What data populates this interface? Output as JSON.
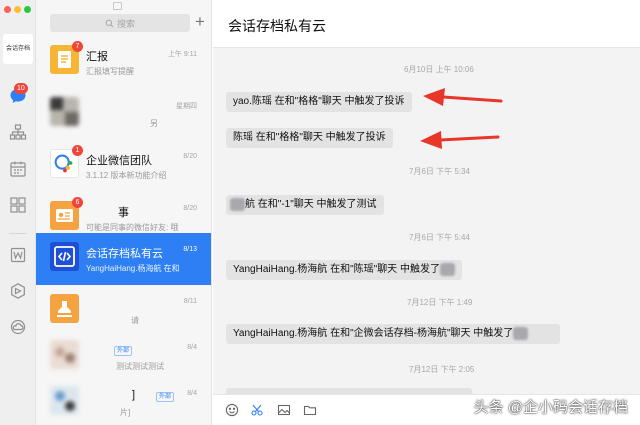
{
  "rail": {
    "org_logo_text": "会话存档",
    "message_badge": "10",
    "icons": [
      "message-icon",
      "org-chart-icon",
      "calendar-icon",
      "grid-icon",
      "doc-icon",
      "drive-icon",
      "cloud-icon"
    ]
  },
  "list": {
    "search_placeholder": "搜索",
    "add_label": "+",
    "conversations": [
      {
        "name": "汇报",
        "preview": "汇报填写提醒",
        "time": "上午 9:11",
        "badge": "7",
        "active": false
      },
      {
        "name": "",
        "preview": "另",
        "time": "星期四",
        "badge": "",
        "active": false
      },
      {
        "name": "企业微信团队",
        "preview": "3.1.12 版本新功能介绍",
        "time": "8/20",
        "badge": "1",
        "active": false
      },
      {
        "name": "事",
        "preview": "可能是同事的微信好友: 哦",
        "time": "8/20",
        "badge": "6",
        "active": false
      },
      {
        "name": "会话存档私有云",
        "preview": "YangHaiHang.杨海航 在和",
        "time": "8/13",
        "badge": "",
        "active": true
      },
      {
        "name": "",
        "preview": "请",
        "time": "8/11",
        "badge": "",
        "active": false
      },
      {
        "name": "",
        "preview": "测试测试测试",
        "time": "8/4",
        "badge": "",
        "active": false,
        "tag": "外部"
      },
      {
        "name": "]",
        "preview": "片]",
        "time": "8/4",
        "badge": "",
        "active": false,
        "tag": "外部"
      }
    ]
  },
  "chat": {
    "title": "会话存档私有云",
    "messages": [
      {
        "time": "6月10日 上午 10:06",
        "text": "yao.陈瑶 在和\"格格\"聊天 中触发了投诉"
      },
      {
        "time": "",
        "text": "陈瑶 在和\"格格\"聊天 中触发了投诉"
      },
      {
        "time": "7月6日 下午 5:34",
        "text": "航 在和\"-1\"聊天 中触发了测试"
      },
      {
        "time": "7月6日 下午 5:44",
        "text": "YangHaiHang.杨海航 在和\"陈瑶\"聊天 中触发了"
      },
      {
        "time": "7月12日 下午 1:49",
        "text": "YangHaiHang.杨海航 在和\"企微会话存档-杨海航\"聊天 中触发了"
      },
      {
        "time": "7月12日 下午 2:05",
        "text": ""
      }
    ]
  },
  "composer": {
    "icons": [
      "emoji-icon",
      "scissors-icon",
      "image-icon",
      "folder-icon"
    ]
  },
  "watermark": "头条 @企小码会话存档",
  "colors": {
    "accent": "#2d7ff3",
    "badge": "#f0453a",
    "arrow": "#e8362b"
  }
}
